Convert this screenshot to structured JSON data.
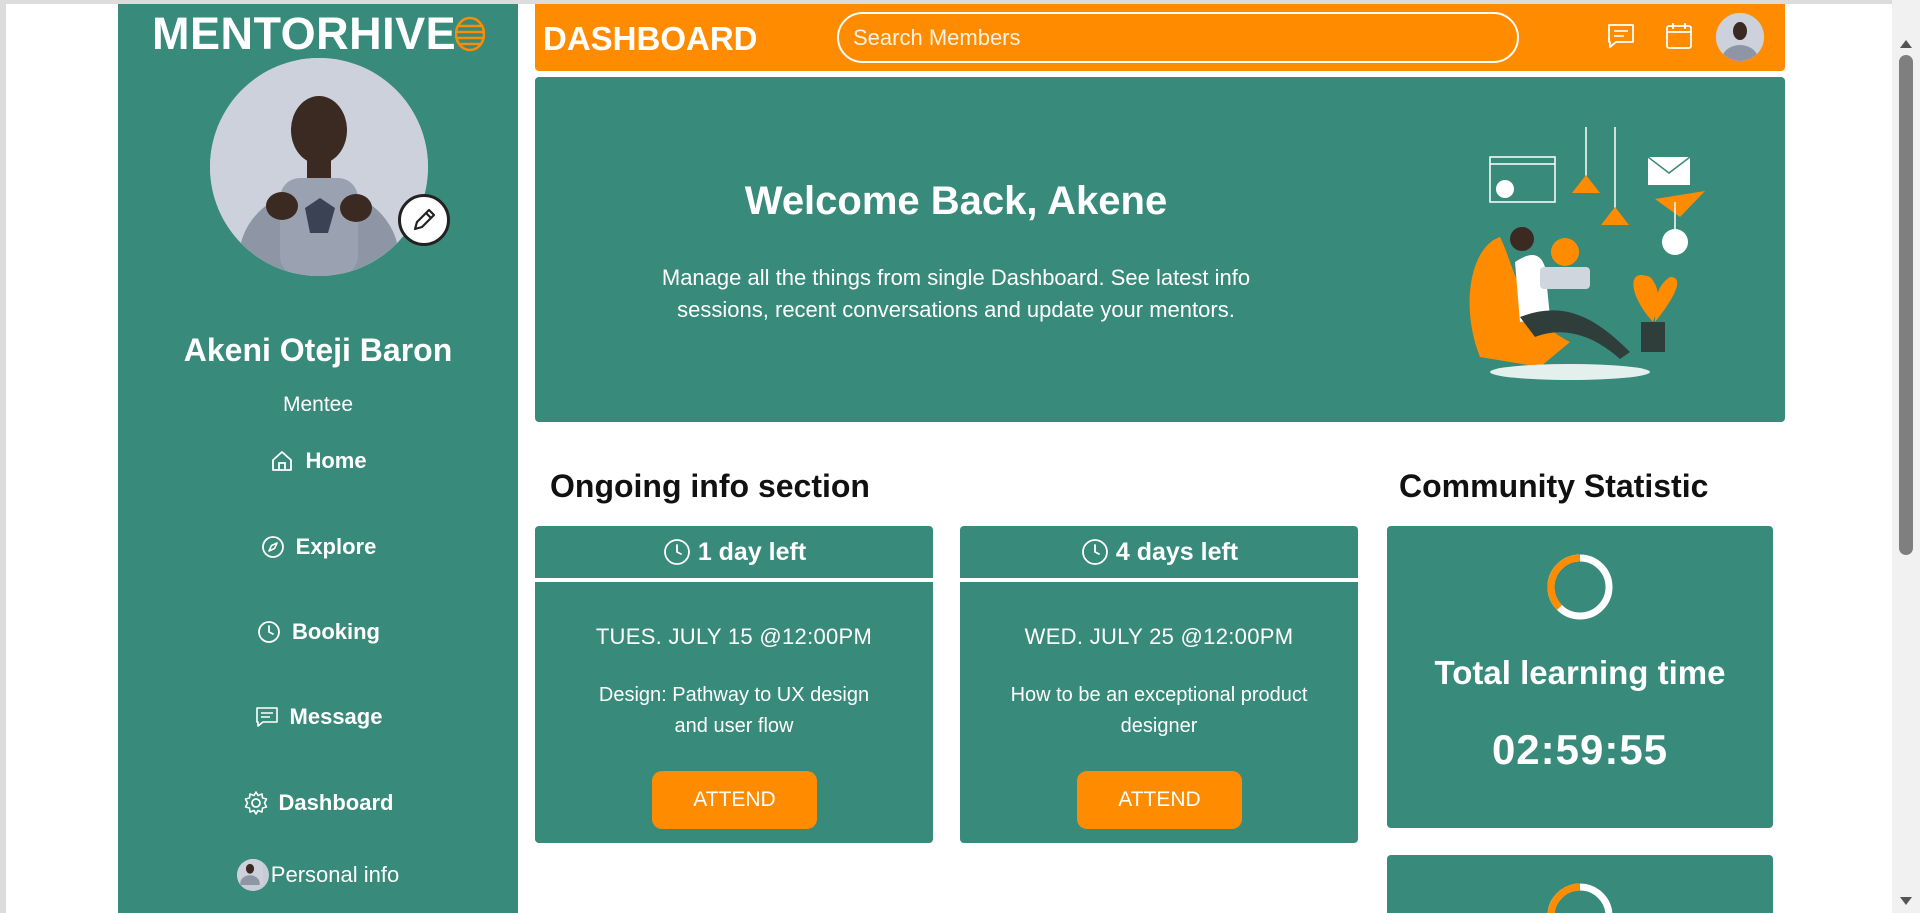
{
  "sidebar": {
    "brand": "MENTORHIVE",
    "profile_name": "Akeni Oteji Baron",
    "profile_role": "Mentee",
    "nav": {
      "home": "Home",
      "explore": "Explore",
      "booking": "Booking",
      "message": "Message",
      "dashboard": "Dashboard",
      "personal": "Personal info"
    }
  },
  "header": {
    "title": "DASHBOARD",
    "search_placeholder": "Search Members"
  },
  "welcome": {
    "title": "Welcome Back, Akene",
    "text": "Manage all the things from single Dashboard. See latest info sessions, recent conversations and update your mentors."
  },
  "ongoing": {
    "title": "Ongoing info section",
    "cards": [
      {
        "time_left": "1 day left",
        "date": "TUES. JULY 15 @12:00PM",
        "desc": "Design: Pathway to UX design and user flow",
        "button": "ATTEND"
      },
      {
        "time_left": "4 days left",
        "date": "WED. JULY 25 @12:00PM",
        "desc": "How to be an exceptional product designer",
        "button": "ATTEND"
      }
    ]
  },
  "community": {
    "title": "Community Statistic",
    "stats": [
      {
        "label": "Total learning time",
        "value": "02:59:55"
      }
    ]
  },
  "colors": {
    "teal": "#388a7b",
    "orange": "#ff8c00",
    "white": "#ffffff"
  },
  "icons": {
    "brand": "stacked-lines-icon",
    "edit": "pencil-icon",
    "home": "home-icon",
    "explore": "compass-icon",
    "booking": "clock-icon",
    "message": "message-icon",
    "dashboard": "gear-icon",
    "header_message": "message-icon",
    "header_calendar": "calendar-icon",
    "card_clock": "clock-icon"
  }
}
